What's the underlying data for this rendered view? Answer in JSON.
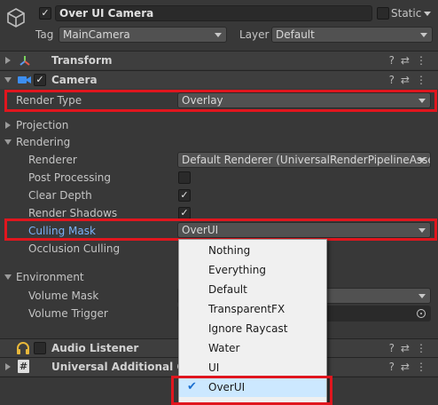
{
  "gameobject": {
    "name": "Over UI Camera",
    "static_label": "Static",
    "tag_label": "Tag",
    "tag_value": "MainCamera",
    "layer_label": "Layer",
    "layer_value": "Default"
  },
  "components": {
    "transform": "Transform",
    "camera": "Camera",
    "audio_listener": "Audio Listener",
    "universal_additional": "Universal Additional Cam"
  },
  "camera": {
    "render_type_label": "Render Type",
    "render_type_value": "Overlay",
    "projection_label": "Projection",
    "rendering_label": "Rendering",
    "renderer_label": "Renderer",
    "renderer_value": "Default Renderer (UniversalRenderPipelineAsse",
    "post_processing_label": "Post Processing",
    "clear_depth_label": "Clear Depth",
    "render_shadows_label": "Render Shadows",
    "culling_mask_label": "Culling Mask",
    "culling_mask_value": "OverUI",
    "occlusion_culling_label": "Occlusion Culling",
    "environment_label": "Environment",
    "volume_mask_label": "Volume Mask",
    "volume_trigger_label": "Volume Trigger"
  },
  "culling_menu": {
    "items": [
      "Nothing",
      "Everything",
      "Default",
      "TransparentFX",
      "Ignore Raycast",
      "Water",
      "UI",
      "OverUI"
    ],
    "selected": "OverUI"
  },
  "colors": {
    "highlight": "#e0161e",
    "accent_blue": "#7ab0f5",
    "selected_row": "#cce8ff"
  }
}
